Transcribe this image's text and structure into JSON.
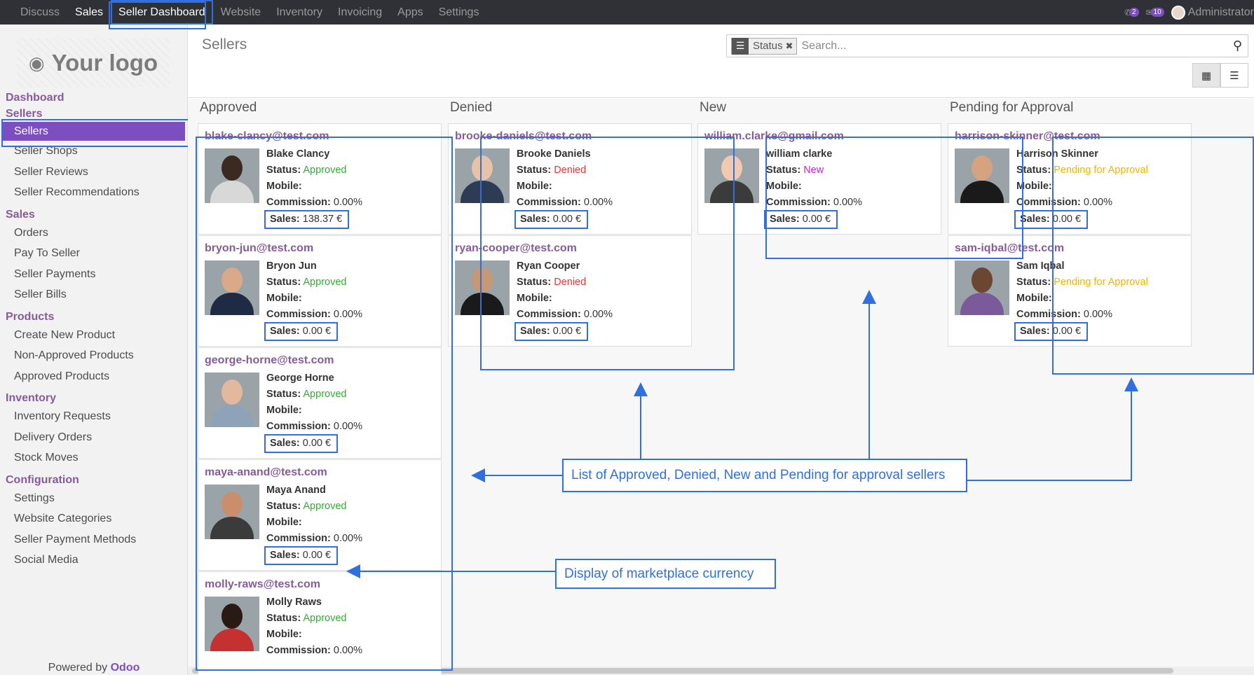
{
  "nav": {
    "items": [
      {
        "label": "Discuss",
        "bright": false,
        "hl": false
      },
      {
        "label": "Sales",
        "bright": true,
        "hl": false
      },
      {
        "label": "Seller Dashboard",
        "bright": true,
        "hl": true
      },
      {
        "label": "Website",
        "bright": false,
        "hl": false
      },
      {
        "label": "Inventory",
        "bright": false,
        "hl": false
      },
      {
        "label": "Invoicing",
        "bright": false,
        "hl": false
      },
      {
        "label": "Apps",
        "bright": false,
        "hl": false
      },
      {
        "label": "Settings",
        "bright": false,
        "hl": false
      }
    ],
    "chat_count": "2",
    "msg_count": "10",
    "user": "Administrator"
  },
  "sidebar": {
    "logo_text": "Your logo",
    "sections": [
      {
        "title": "Dashboard",
        "items": []
      },
      {
        "title": "Sellers",
        "items": [
          {
            "label": "Sellers",
            "active": true
          },
          {
            "label": "Seller Shops"
          },
          {
            "label": "Seller Reviews"
          },
          {
            "label": "Seller Recommendations"
          }
        ]
      },
      {
        "title": "Sales",
        "items": [
          {
            "label": "Orders"
          },
          {
            "label": "Pay To Seller"
          },
          {
            "label": "Seller Payments"
          },
          {
            "label": "Seller Bills"
          }
        ]
      },
      {
        "title": "Products",
        "items": [
          {
            "label": "Create New Product"
          },
          {
            "label": "Non-Approved Products"
          },
          {
            "label": "Approved Products"
          }
        ]
      },
      {
        "title": "Inventory",
        "items": [
          {
            "label": "Inventory Requests"
          },
          {
            "label": "Delivery Orders"
          },
          {
            "label": "Stock Moves"
          }
        ]
      },
      {
        "title": "Configuration",
        "items": [
          {
            "label": "Settings"
          },
          {
            "label": "Website Categories"
          },
          {
            "label": "Seller Payment Methods"
          },
          {
            "label": "Social Media"
          }
        ]
      }
    ],
    "powered_prefix": "Powered by",
    "powered_brand": "Odoo"
  },
  "control": {
    "title": "Sellers",
    "facet_label": "Status",
    "search_placeholder": "Search..."
  },
  "labels": {
    "status": "Status:",
    "mobile": "Mobile:",
    "commission": "Commission:",
    "sales": "Sales:"
  },
  "columns": [
    {
      "title": "Approved",
      "cards": [
        {
          "email": "blake-clancy@test.com",
          "name": "Blake Clancy",
          "status": "Approved",
          "commission": "0.00%",
          "sales": "138.37 €"
        },
        {
          "email": "bryon-jun@test.com",
          "name": "Bryon Jun",
          "status": "Approved",
          "commission": "0.00%",
          "sales": "0.00 €"
        },
        {
          "email": "george-horne@test.com",
          "name": "George Horne",
          "status": "Approved",
          "commission": "0.00%",
          "sales": "0.00 €"
        },
        {
          "email": "maya-anand@test.com",
          "name": "Maya Anand",
          "status": "Approved",
          "commission": "0.00%",
          "sales": "0.00 €"
        },
        {
          "email": "molly-raws@test.com",
          "name": "Molly Raws",
          "status": "Approved",
          "commission": "0.00%",
          "sales": ""
        }
      ]
    },
    {
      "title": "Denied",
      "cards": [
        {
          "email": "brooke-daniels@test.com",
          "name": "Brooke Daniels",
          "status": "Denied",
          "commission": "0.00%",
          "sales": "0.00 €"
        },
        {
          "email": "ryan-cooper@test.com",
          "name": "Ryan Cooper",
          "status": "Denied",
          "commission": "0.00%",
          "sales": "0.00 €"
        }
      ]
    },
    {
      "title": "New",
      "cards": [
        {
          "email": "william.clarke@gmail.com",
          "name": "william clarke",
          "status": "New",
          "commission": "0.00%",
          "sales": "0.00 €"
        }
      ]
    },
    {
      "title": "Pending for Approval",
      "cards": [
        {
          "email": "harrison-skinner@test.com",
          "name": "Harrison Skinner",
          "status": "Pending for Approval",
          "commission": "0.00%",
          "sales": "0.00 €"
        },
        {
          "email": "sam-iqbal@test.com",
          "name": "Sam Iqbal",
          "status": "Pending for Approval",
          "commission": "0.00%",
          "sales": "0.00 €"
        }
      ]
    }
  ],
  "callouts": {
    "list": "List of Approved, Denied, New and Pending for approval sellers",
    "currency": "Display of marketplace currency"
  },
  "colors": {
    "accent": "#7c4fc0",
    "annotation": "#2f6fe0",
    "approved": "#2fae2f",
    "denied": "#ee3333",
    "new": "#c41fe0",
    "pending": "#f1b300"
  }
}
